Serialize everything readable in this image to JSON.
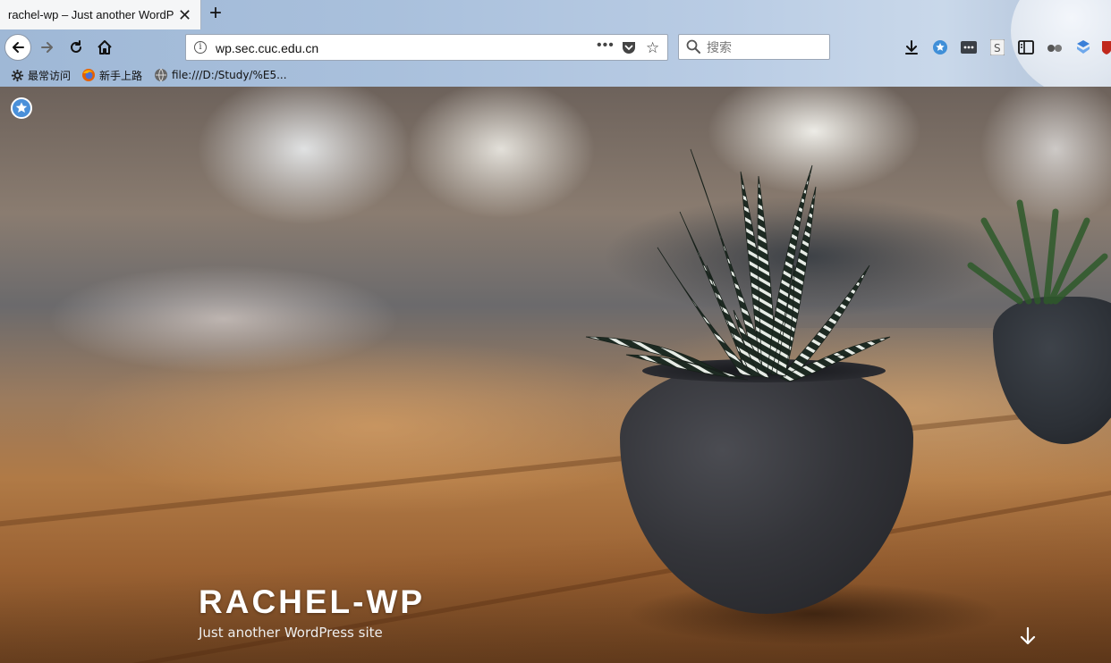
{
  "browser": {
    "tab_title": "rachel-wp – Just another WordPress site",
    "tab_close": "✕",
    "new_tab": "+",
    "url": "wp.sec.cuc.edu.cn",
    "url_more": "•••",
    "search_placeholder": "搜索",
    "bookmarks": [
      {
        "label": "最常访问",
        "icon": "gear-icon"
      },
      {
        "label": "新手上路",
        "icon": "firefox-icon"
      },
      {
        "label": "file:///D:/Study/%E5...",
        "icon": "globe-icon"
      }
    ],
    "toolbar_icons": [
      "download-icon",
      "extension-star-icon",
      "extension-dots-icon",
      "extension-s-icon",
      "sidebar-icon",
      "extension-glasses-icon",
      "extension-shield-icon",
      "extension-red-icon"
    ]
  },
  "site": {
    "title": "RACHEL-WP",
    "tagline": "Just another WordPress site"
  },
  "colors": {
    "accent_badge": "#4a90d9",
    "title_text": "#ffffff"
  }
}
